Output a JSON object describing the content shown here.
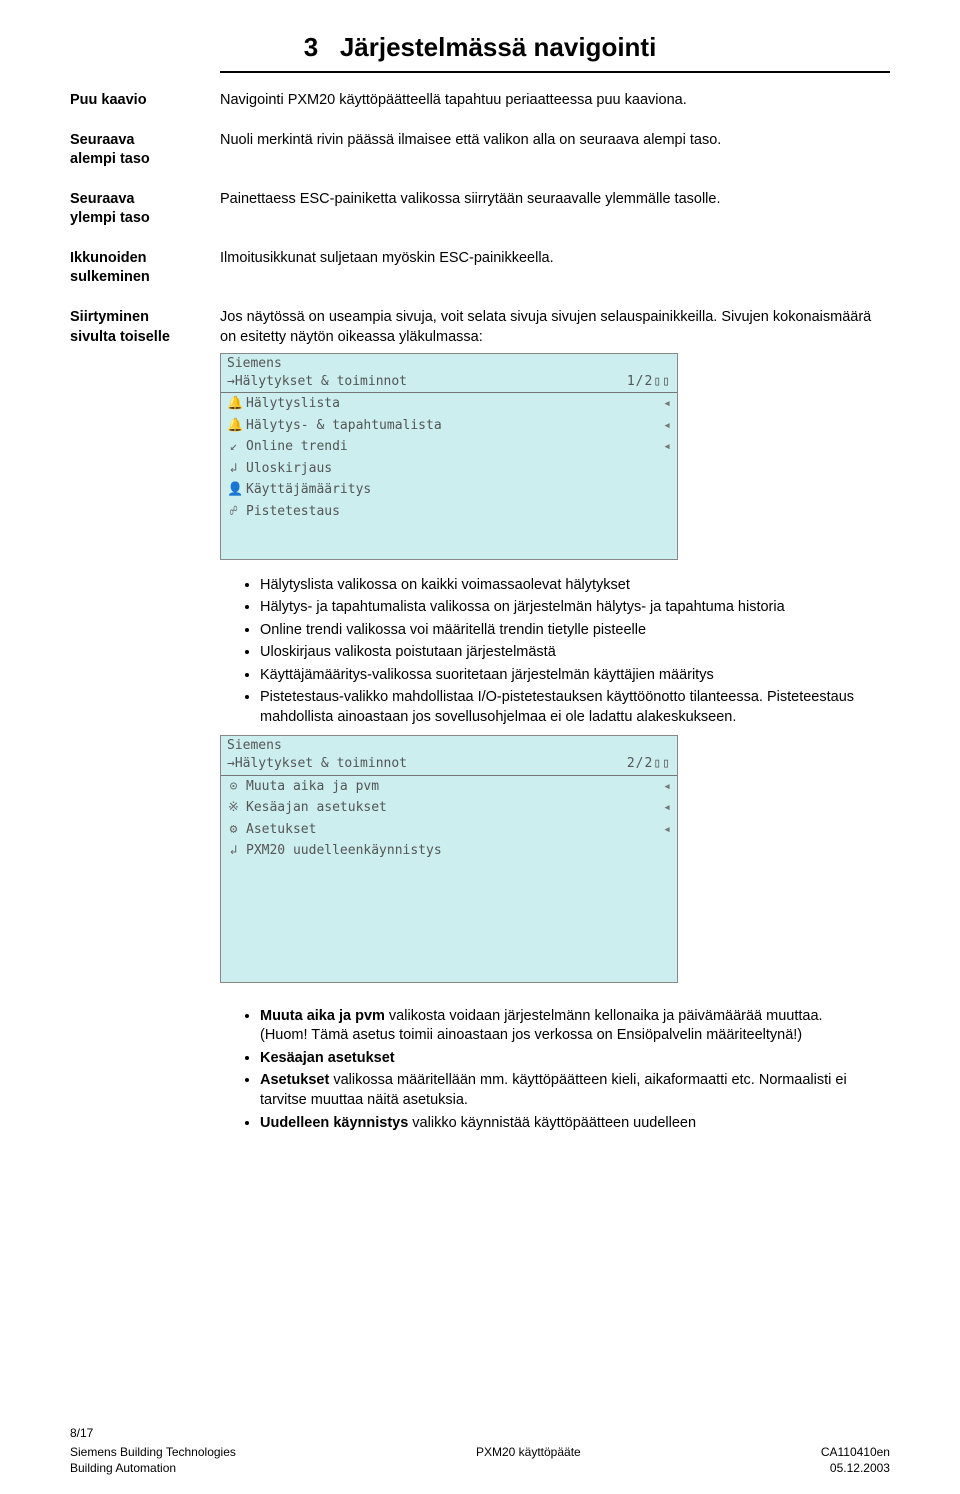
{
  "chapter": {
    "num": "3",
    "title": "Järjestelmässä navigointi"
  },
  "defs": [
    {
      "label1": "Puu kaavio",
      "label2": "",
      "body": "Navigointi PXM20 käyttöpäätteellä tapahtuu periaatteessa puu kaaviona."
    },
    {
      "label1": "Seuraava",
      "label2": "alempi taso",
      "body": "Nuoli merkintä rivin päässä ilmaisee että valikon alla on seuraava alempi taso."
    },
    {
      "label1": "Seuraava",
      "label2": "ylempi taso",
      "body": "Painettaess ESC-painiketta valikossa siirrytään seuraavalle ylemmälle tasolle."
    },
    {
      "label1": "Ikkunoiden",
      "label2": "sulkeminen",
      "body": "Ilmoitusikkunat suljetaan myöskin ESC-painikkeella."
    },
    {
      "label1": "Siirtyminen",
      "label2": "sivulta toiselle",
      "body": "Jos näytössä on useampia sivuja, voit selata sivuja sivujen selauspainikkeilla. Sivujen kokonaismäärä on esitetty näytön oikeassa yläkulmassa:"
    }
  ],
  "screen1": {
    "brand": "Siemens",
    "path": "→Hälytykset & toiminnot",
    "page": "1/2▯▯",
    "items": [
      {
        "icon": "🔔",
        "label": "Hälytyslista",
        "arrow": "◂"
      },
      {
        "icon": "🔔",
        "label": "Hälytys- & tapahtumalista",
        "arrow": "◂"
      },
      {
        "icon": "↙",
        "label": "Online trendi",
        "arrow": "◂"
      },
      {
        "icon": "↲",
        "label": "Uloskirjaus",
        "arrow": ""
      },
      {
        "icon": "👤",
        "label": "Käyttäjämääritys",
        "arrow": ""
      },
      {
        "icon": "☍",
        "label": "Pistetestaus",
        "arrow": ""
      }
    ]
  },
  "bullets1": [
    "Hälytyslista valikossa on kaikki voimassaolevat hälytykset",
    "Hälytys- ja tapahtumalista valikossa on järjestelmän hälytys- ja tapahtuma historia",
    "Online trendi valikossa voi määritellä trendin tietylle pisteelle",
    "Uloskirjaus valikosta poistutaan järjestelmästä",
    "Käyttäjämääritys-valikossa suoritetaan järjestelmän käyttäjien määritys",
    "Pistetestaus-valikko mahdollistaa I/O-pistetestauksen käyttöönotto tilanteessa. Pisteteestaus mahdollista ainoastaan jos sovellusohjelmaa ei ole ladattu alakeskukseen."
  ],
  "screen2": {
    "brand": "Siemens",
    "path": "→Hälytykset & toiminnot",
    "page": "2/2▯▯",
    "items": [
      {
        "icon": "⊙",
        "label": "Muuta aika ja pvm",
        "arrow": "◂"
      },
      {
        "icon": "※",
        "label": "Kesäajan asetukset",
        "arrow": "◂"
      },
      {
        "icon": "⚙",
        "label": "Asetukset",
        "arrow": "◂"
      },
      {
        "icon": "↲",
        "label": "PXM20 uudelleenkäynnistys",
        "arrow": ""
      }
    ]
  },
  "bullets2": {
    "i0": {
      "bold": "Muuta aika ja pvm",
      "rest": " valikosta voidaan järjestelmänn kellonaika ja päivämäärää muuttaa. (Huom! Tämä asetus toimii ainoastaan jos verkossa on Ensiöpalvelin määriteeltynä!)"
    },
    "i1": {
      "bold": "Kesäajan asetukset",
      "rest": ""
    },
    "i2": {
      "bold": "Asetukset",
      "rest": " valikossa määritellään mm. käyttöpäätteen kieli, aikaformaatti etc. Normaalisti ei tarvitse muuttaa näitä asetuksia."
    },
    "i3": {
      "bold": "Uudelleen käynnistys",
      "rest": " valikko käynnistää käyttöpäätteen uudelleen"
    }
  },
  "footer": {
    "pgno": "8/17",
    "l1a": "Siemens Building Technologies",
    "l1b": "PXM20 käyttöpääte",
    "l1c": "CA110410en",
    "l2a": "Building Automation",
    "l2c": "05.12.2003"
  }
}
